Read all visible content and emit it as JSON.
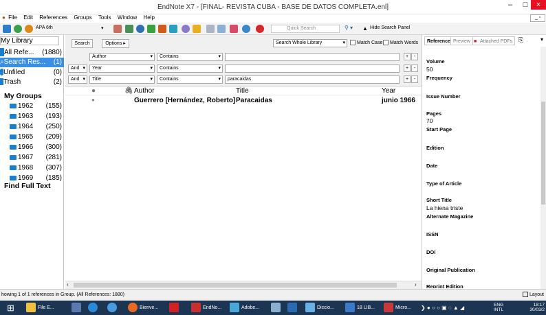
{
  "window": {
    "title": "EndNote X7 - [FINAL- REVISTA CUBA - BASE DE DATOS COMPLETA.enl]",
    "minimize": "–",
    "maximize": "□",
    "close": "×"
  },
  "menu": [
    "File",
    "Edit",
    "References",
    "Groups",
    "Tools",
    "Window",
    "Help"
  ],
  "toolbar": {
    "style": "APA 6th",
    "quick_search_placeholder": "Quick Search",
    "hide_panel": "Hide Search Panel"
  },
  "sidebar": {
    "my_library": "My Library",
    "items": [
      {
        "label": "All Refe...",
        "count": "(1880)"
      },
      {
        "label": "Search Res...",
        "count": "(1)"
      },
      {
        "label": "Unfiled",
        "count": "(0)"
      },
      {
        "label": "Trash",
        "count": "(2)"
      }
    ],
    "my_groups": "My Groups",
    "groups": [
      {
        "label": "1962",
        "count": "(155)"
      },
      {
        "label": "1963",
        "count": "(193)"
      },
      {
        "label": "1964",
        "count": "(250)"
      },
      {
        "label": "1965",
        "count": "(209)"
      },
      {
        "label": "1966",
        "count": "(300)"
      },
      {
        "label": "1967",
        "count": "(281)"
      },
      {
        "label": "1968",
        "count": "(307)"
      },
      {
        "label": "1969",
        "count": "(185)"
      }
    ],
    "find_full_text": "Find Full Text"
  },
  "search": {
    "search_btn": "Search",
    "options_btn": "Options ▸",
    "scope": "Search Whole Library",
    "match_case": "Match Case",
    "match_words": "Match Words",
    "rows": [
      {
        "bool": "",
        "field": "Author",
        "op": "Contains",
        "value": ""
      },
      {
        "bool": "And",
        "field": "Year",
        "op": "Contains",
        "value": ""
      },
      {
        "bool": "And",
        "field": "Title",
        "op": "Contains",
        "value": "paracaidas"
      }
    ]
  },
  "results": {
    "columns": {
      "author": "Author",
      "title": "Title",
      "year": "Year"
    },
    "rows": [
      {
        "author": "Guerrero [Hernández, Roberto]",
        "title": "Paracaidas",
        "year": "junio 1966"
      }
    ]
  },
  "right_panel": {
    "tabs": [
      "Reference",
      "Preview",
      "Attached PDFs"
    ],
    "fields": [
      {
        "label": "Volume",
        "value": "50"
      },
      {
        "label": "Frequency",
        "value": ""
      },
      {
        "label": "Issue Number",
        "value": ""
      },
      {
        "label": "Pages",
        "value": "70"
      },
      {
        "label": "Start Page",
        "value": ""
      },
      {
        "label": "Edition",
        "value": ""
      },
      {
        "label": "Date",
        "value": ""
      },
      {
        "label": "Type of Article",
        "value": ""
      },
      {
        "label": "Short Title",
        "value": "La hiena triste"
      },
      {
        "label": "Alternate Magazine",
        "value": ""
      },
      {
        "label": "ISSN",
        "value": ""
      },
      {
        "label": "DOI",
        "value": ""
      },
      {
        "label": "Original Publication",
        "value": ""
      },
      {
        "label": "Reprint Edition",
        "value": ""
      }
    ]
  },
  "status": {
    "text": "howing 1 of 1 references in Group. (All References: 1880)",
    "layout": "Layout"
  },
  "taskbar": {
    "items": [
      "File E...",
      "Bienve...",
      "EndNo...",
      "Adobe...",
      "Diccio...",
      "18 LIB...",
      "Micro..."
    ],
    "lang": "ENG",
    "lang2": "INTL",
    "time": "18:17",
    "date": "30/03/2"
  }
}
